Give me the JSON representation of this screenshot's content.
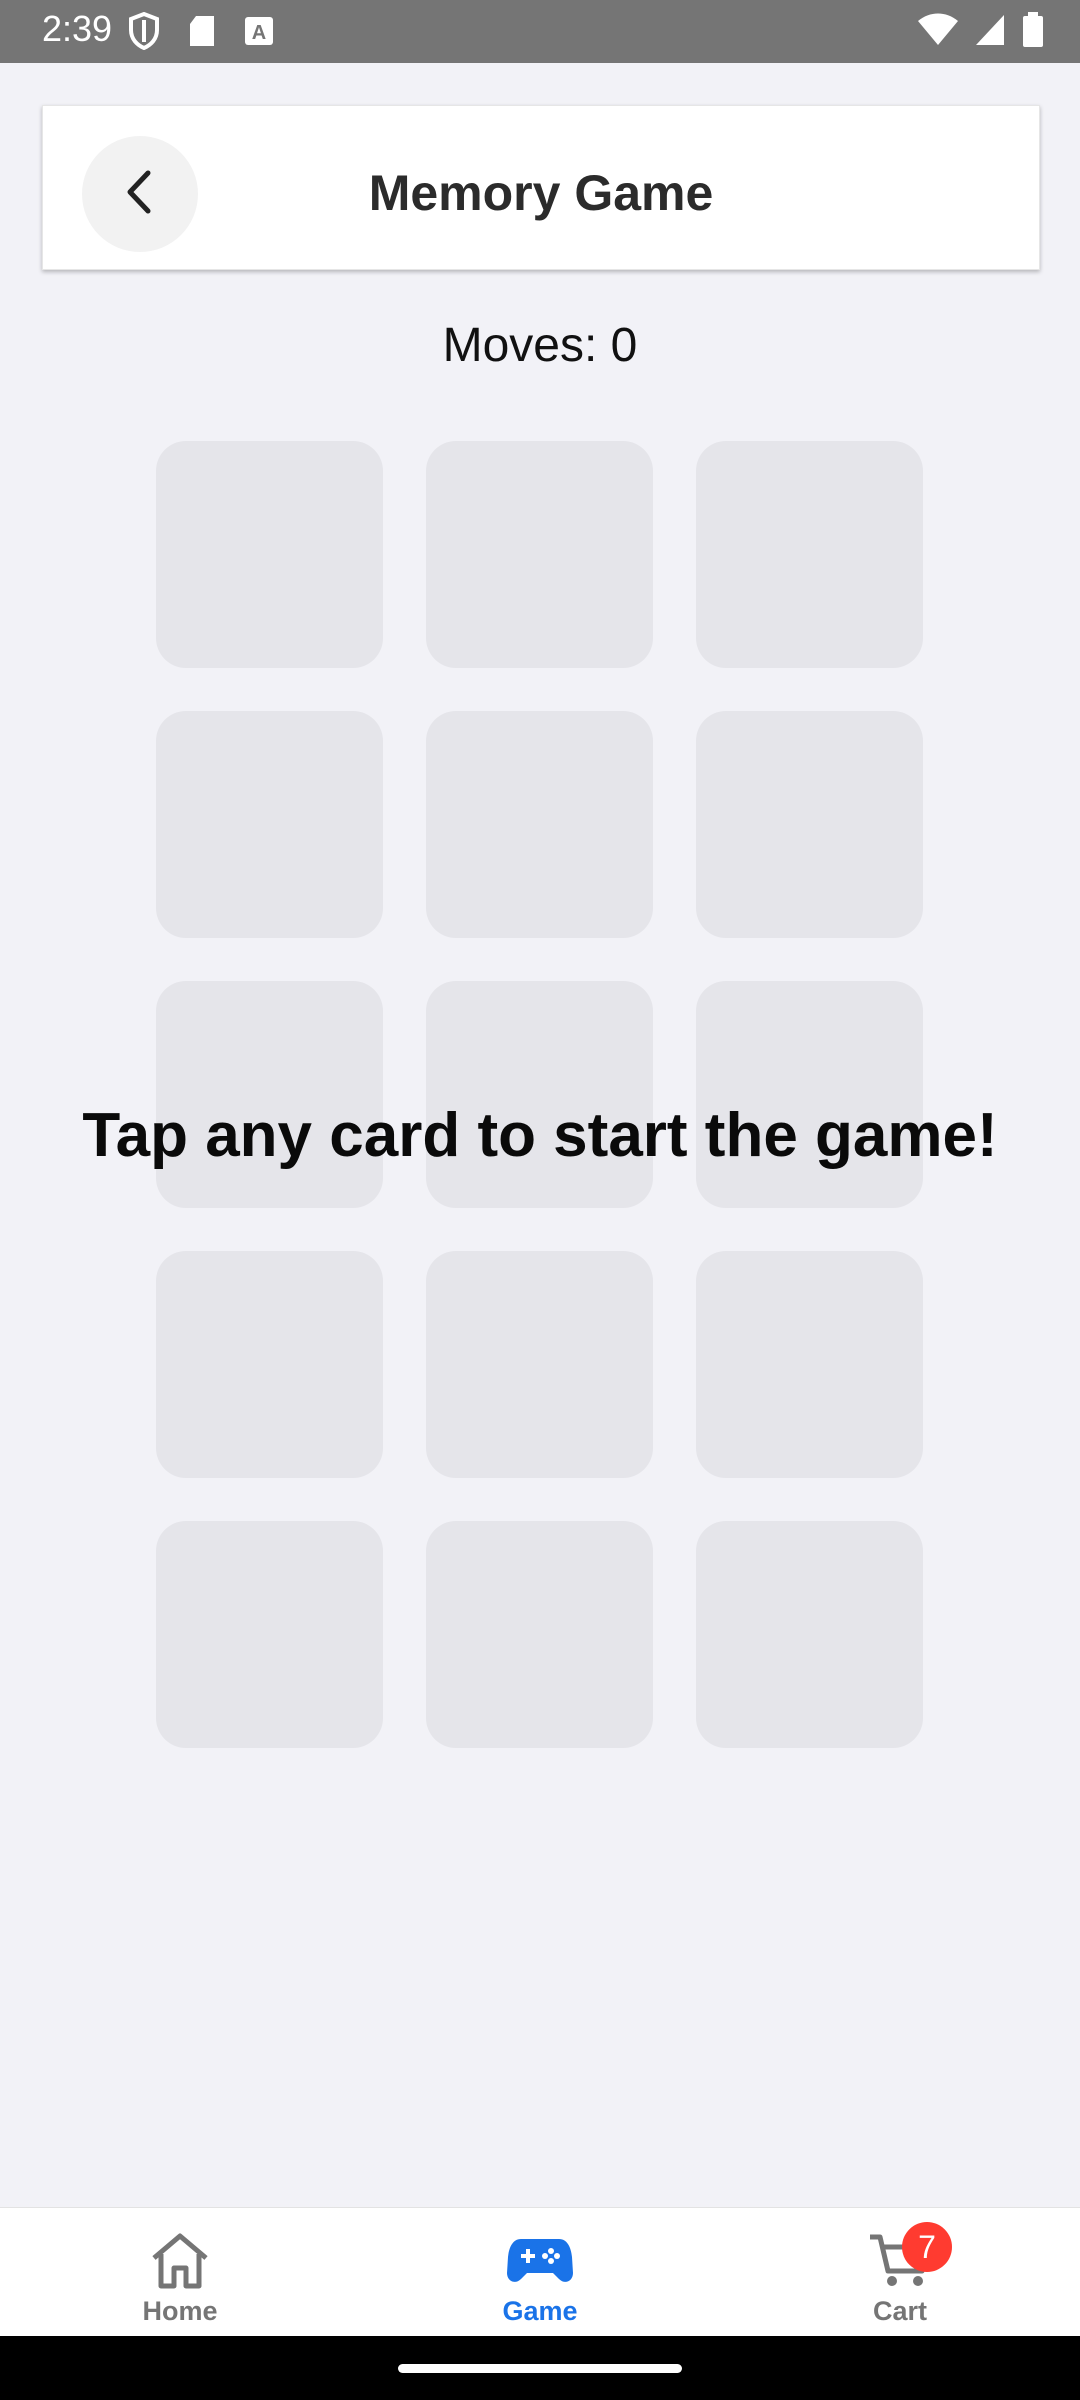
{
  "status_bar": {
    "time": "2:39",
    "icons_left": [
      "shield-icon",
      "sd-card-icon",
      "font-icon"
    ],
    "icons_right": [
      "wifi-icon",
      "signal-icon",
      "battery-icon"
    ]
  },
  "header": {
    "title": "Memory Game",
    "back_icon": "chevron-left-icon"
  },
  "game": {
    "moves_text": "Moves: 0",
    "overlay_text": "Tap any card to start the game!",
    "cards": [
      {},
      {},
      {},
      {},
      {},
      {},
      {},
      {},
      {},
      {},
      {},
      {},
      {},
      {},
      {}
    ],
    "card_color": "#e5e5ea"
  },
  "bottom_nav": {
    "items": [
      {
        "label": "Home",
        "icon": "home-icon",
        "active": false
      },
      {
        "label": "Game",
        "icon": "gamepad-icon",
        "active": true
      },
      {
        "label": "Cart",
        "icon": "cart-icon",
        "active": false,
        "badge": "7"
      }
    ],
    "active_color": "#1a73e8",
    "inactive_color": "#757575",
    "badge_color": "#ff3b30"
  }
}
